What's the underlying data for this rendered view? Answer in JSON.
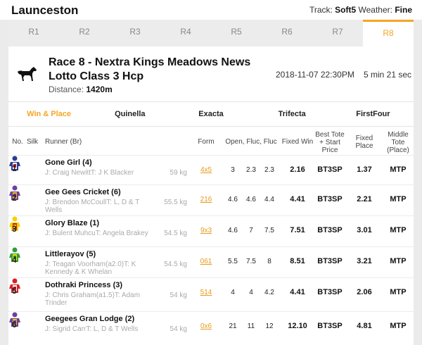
{
  "header": {
    "venue": "Launceston",
    "track_label": "Track:",
    "track_value": "Soft5",
    "weather_label": "Weather:",
    "weather_value": "Fine"
  },
  "race_tabs": [
    "R1",
    "R2",
    "R3",
    "R4",
    "R5",
    "R6",
    "R7",
    "R8"
  ],
  "active_race_tab": 7,
  "race": {
    "title": "Race 8 - Nextra Kings Meadows News Lotto Class 3 Hcp",
    "distance_label": "Distance:",
    "distance_value": "1420m",
    "datetime": "2018-11-07 22:30PM",
    "countdown": "5 min 21 sec"
  },
  "bet_tabs": [
    "Win & Place",
    "Quinella",
    "Exacta",
    "Trifecta",
    "FirstFour"
  ],
  "active_bet_tab": 0,
  "columns": {
    "no": "No.",
    "silk": "Silk",
    "runner": "Runner (Br)",
    "form": "Form",
    "open_fluc": "Open, Fluc, Fluc",
    "fixed_win": "Fixed Win",
    "best_tote": "Best Tote + Start Price",
    "fixed_place": "Fixed Place",
    "middle_tote": "Middle Tote (Place)"
  },
  "colors": {
    "accent": "#f5a623"
  },
  "runners": [
    {
      "no": "1",
      "name": "Gone Girl (4)",
      "jt": "J: Craig NewittT: J K Blacker",
      "weight": "59 kg",
      "form": "4x5",
      "open": "3",
      "fluc1": "2.3",
      "fluc2": "2.3",
      "fixed_win": "2.16",
      "best_tote": "BT3SP",
      "fixed_place": "1.37",
      "middle_tote": "MTP",
      "silk": [
        "#2a3d8f",
        "#ffffff",
        "#c0182a"
      ]
    },
    {
      "no": "2",
      "name": "Gee Gees Cricket (6)",
      "jt": "J: Brendon McCoullT: L, D & T Wells",
      "weight": "55.5 kg",
      "form": "216",
      "open": "4.6",
      "fluc1": "4.6",
      "fluc2": "4.4",
      "fixed_win": "4.41",
      "best_tote": "BT3SP",
      "fixed_place": "2.21",
      "middle_tote": "MTP",
      "silk": [
        "#6b3fa0",
        "#f2c200",
        "#6b3fa0"
      ]
    },
    {
      "no": "3",
      "name": "Glory Blaze (1)",
      "jt": "J: Bulent MuhcuT: Angela Brakey",
      "weight": "54.5 kg",
      "form": "9x3",
      "open": "4.6",
      "fluc1": "7",
      "fluc2": "7.5",
      "fixed_win": "7.51",
      "best_tote": "BT3SP",
      "fixed_place": "3.01",
      "middle_tote": "MTP",
      "silk": [
        "#f2d400",
        "#e2161b",
        "#f2d400"
      ]
    },
    {
      "no": "4",
      "name": "Littlerayov (5)",
      "jt": "J: Teagan Voorham(a2.0)T: K Kennedy & K Whelan",
      "weight": "54.5 kg",
      "form": "061",
      "open": "5.5",
      "fluc1": "7.5",
      "fluc2": "8",
      "fixed_win": "8.51",
      "best_tote": "BT3SP",
      "fixed_place": "3.21",
      "middle_tote": "MTP",
      "silk": [
        "#2e9e3a",
        "#f5e000",
        "#2e9e3a"
      ]
    },
    {
      "no": "5",
      "name": "Dothraki Princess (3)",
      "jt": "J: Chris Graham(a1.5)T: Adam Trinder",
      "weight": "54 kg",
      "form": "514",
      "open": "4",
      "fluc1": "4",
      "fluc2": "4.2",
      "fixed_win": "4.41",
      "best_tote": "BT3SP",
      "fixed_place": "2.06",
      "middle_tote": "MTP",
      "silk": [
        "#d81f26",
        "#ffffff",
        "#d81f26"
      ]
    },
    {
      "no": "6",
      "name": "Geegees Gran Lodge (2)",
      "jt": "J: Sigrid CarrT: L, D & T Wells",
      "weight": "54 kg",
      "form": "0x6",
      "open": "21",
      "fluc1": "11",
      "fluc2": "12",
      "fixed_win": "12.10",
      "best_tote": "BT3SP",
      "fixed_place": "4.81",
      "middle_tote": "MTP",
      "silk": [
        "#6b3fa0",
        "#f2c200",
        "#6b3fa0"
      ]
    }
  ]
}
